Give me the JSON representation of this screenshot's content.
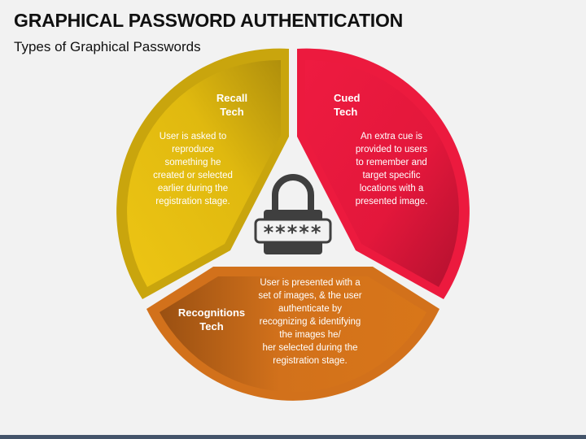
{
  "header": {
    "title": "GRAPHICAL PASSWORD AUTHENTICATION",
    "subtitle": "Types of Graphical Passwords"
  },
  "segments": [
    {
      "id": "recall",
      "title": "Recall\nTech",
      "description": "User is asked to\nreproduce\nsomething he\ncreated or selected\nearlier during the\nregistration stage.",
      "color": "#e8bf12",
      "color_dark": "#b89a0e"
    },
    {
      "id": "cued",
      "title": "Cued\nTech",
      "description": "An extra cue is\nprovided to users\nto remember and\ntarget specific\nlocations with a\npresented image.",
      "color": "#ec1a3e",
      "color_dark": "#b5112f"
    },
    {
      "id": "recognitions",
      "title": "Recognitions\nTech",
      "description": "User is presented with a\nset of images, & the user\nauthenticate by\nrecognizing & identifying\nthe images he/\nher selected during the\nregistration stage.",
      "color": "#d2711b",
      "color_dark": "#a25612"
    }
  ],
  "center_icon": {
    "name": "padlock-password-icon",
    "masked_text": "*****",
    "color": "#3f3f3f"
  },
  "footer": {
    "bar_color": "#44546a"
  }
}
